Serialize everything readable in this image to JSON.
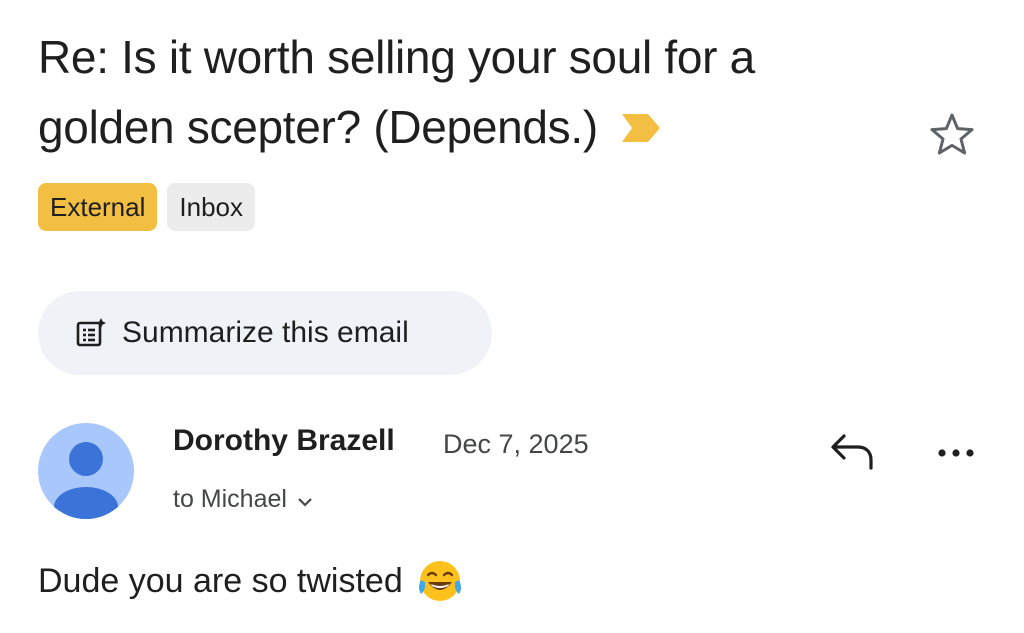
{
  "email": {
    "subject": "Re: Is it worth selling your soul for a golden scepter? (Depends.)",
    "importance_icon": "importance-marker-icon",
    "star_icon": "star-outline-icon",
    "labels": [
      {
        "text": "External",
        "color": "#f2bf42"
      },
      {
        "text": "Inbox",
        "color": "#ececec"
      }
    ],
    "summarize": {
      "label": "Summarize this email",
      "icon": "summarize-icon"
    },
    "sender": {
      "name": "Dorothy Brazell",
      "date": "Dec 7, 2025",
      "recipient": "to Michael",
      "avatar_color": "#a8c7fa"
    },
    "actions": {
      "reply_icon": "reply-icon",
      "more_icon": "more-horizontal-icon"
    },
    "body": "Dude you are so twisted",
    "body_emoji": "face-with-tears-of-joy-icon"
  }
}
